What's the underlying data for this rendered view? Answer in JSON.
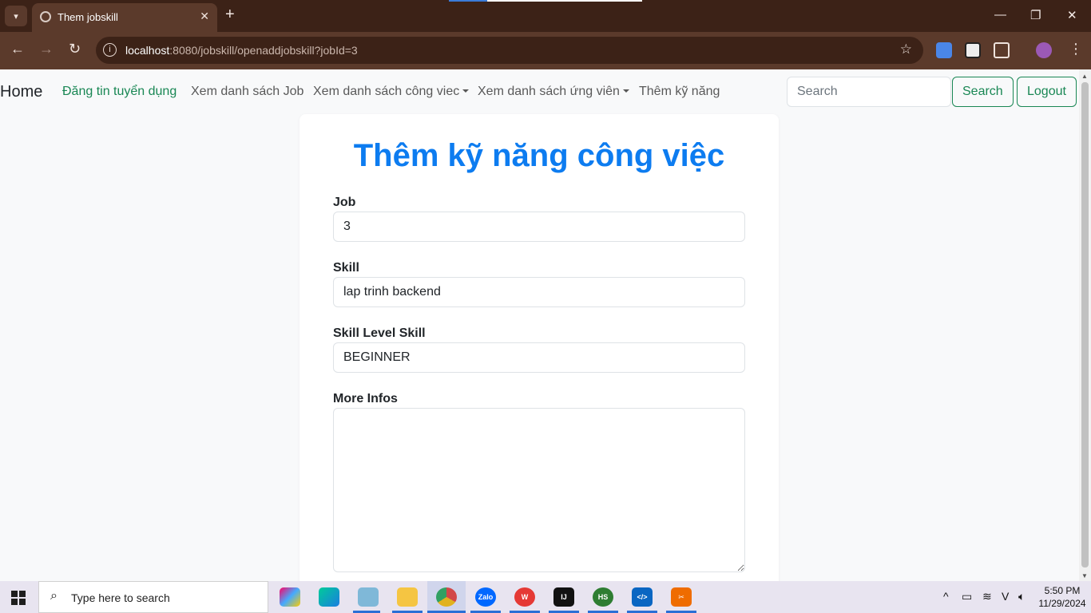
{
  "browser": {
    "tab_title": "Them jobskill",
    "tab_close": "✕",
    "new_tab": "+",
    "url_host": "localhost",
    "url_rest": ":8080/jobskill/openaddjobskill?jobId=3",
    "window_controls": [
      "—",
      "❐",
      "✕"
    ]
  },
  "navbar": {
    "brand": "Home",
    "links": [
      {
        "label": "Đăng tin tuyển dụng",
        "active": true
      },
      {
        "label": "Xem danh sách Job"
      },
      {
        "label": "Xem danh sách công viec",
        "dropdown": true
      },
      {
        "label": "Xem danh sách ứng viên",
        "dropdown": true
      },
      {
        "label": "Thêm kỹ năng"
      }
    ],
    "search_placeholder": "Search",
    "search_button": "Search",
    "logout_button": "Logout"
  },
  "form": {
    "title": "Thêm kỹ năng công việc",
    "job_label": "Job",
    "job_value": "3",
    "skill_label": "Skill",
    "skill_value": "lap trinh backend",
    "level_label": "Skill Level Skill",
    "level_value": "BEGINNER",
    "more_label": "More Infos",
    "more_value": ""
  },
  "taskbar": {
    "search_text": "Type here to search",
    "time": "5:50 PM",
    "date": "11/29/2024",
    "apps": [
      "copilot",
      "edge",
      "files-app",
      "file-explorer",
      "chrome",
      "zalo",
      "wps",
      "intellij",
      "hs",
      "vscode",
      "snipping-tool"
    ]
  },
  "colors": {
    "accent_green": "#198754",
    "title_blue": "#0d7cf0",
    "chrome_dark": "#3c2217",
    "chrome_mid": "#5b3a2b"
  }
}
